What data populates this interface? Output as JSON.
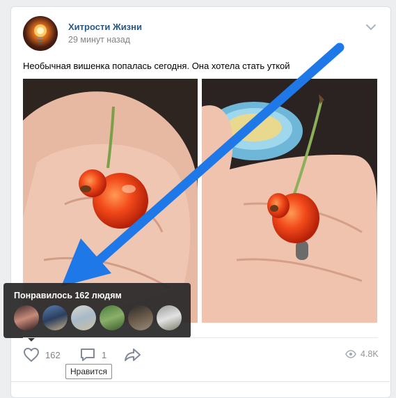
{
  "post": {
    "author": "Хитрости Жизни",
    "time": "29 минут назад",
    "text": "Необычная вишенка попалась сегодня. Она хотела стать уткой"
  },
  "likes_tooltip": {
    "title": "Понравилось 162 людям"
  },
  "actions": {
    "like_count": "162",
    "comment_count": "1",
    "views": "4.8K",
    "like_hint": "Нравится"
  },
  "colors": {
    "author_link": "#2a5885",
    "arrow": "#1e78e8",
    "tooltip_bg": "#282828"
  },
  "icons": {
    "menu": "chevron-down-icon",
    "like": "heart-icon",
    "comment": "comment-icon",
    "share": "share-arrow-icon",
    "views": "eye-icon"
  }
}
